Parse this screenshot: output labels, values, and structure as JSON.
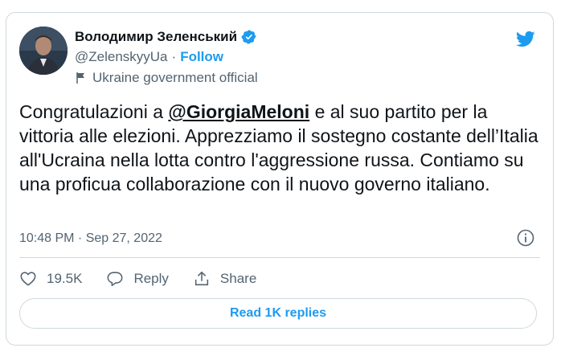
{
  "author": {
    "name": "Володимир Зеленський",
    "handle": "@ZelenskyyUa",
    "separator": "·",
    "follow_label": "Follow",
    "account_label": "Ukraine government official"
  },
  "tweet": {
    "text_before": "Congratulazioni a ",
    "mention": "@GiorgiaMeloni",
    "text_after": " e al suo partito per la vittoria alle elezioni. Apprezziamo il sostegno costante dell’Italia all'Ucraina nella lotta contro l'aggressione russa. Contiamo su una proficua collaborazione con il nuovo governo italiano.",
    "timestamp": "10:48 PM · Sep 27, 2022"
  },
  "actions": {
    "likes_count": "19.5K",
    "reply_label": "Reply",
    "share_label": "Share"
  },
  "replies_button": "Read 1K replies",
  "colors": {
    "accent": "#1d9bf0",
    "text": "#0f1419",
    "muted": "#536471",
    "border": "#cfd9de"
  },
  "icons": [
    "verified-badge-icon",
    "twitter-bird-icon",
    "flag-icon",
    "info-icon",
    "heart-icon",
    "reply-icon",
    "share-icon"
  ]
}
